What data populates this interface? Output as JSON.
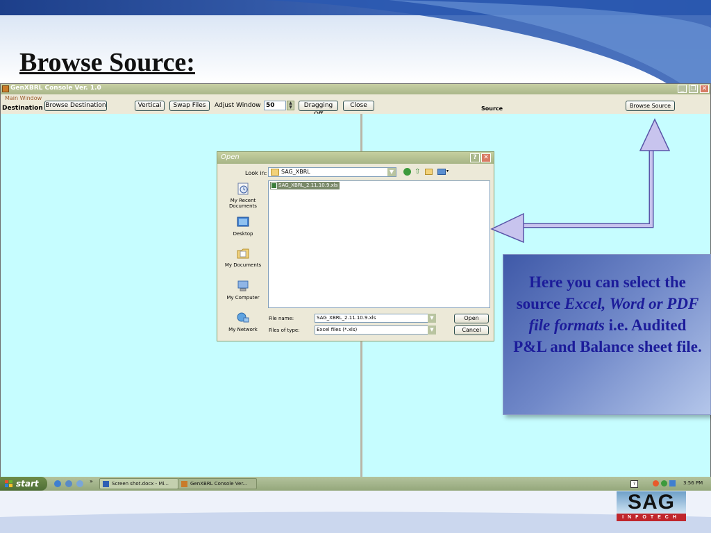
{
  "slide": {
    "title": "Browse Source:"
  },
  "app": {
    "window_title": "GenXBRL Console Ver. 1.0",
    "menu_item": "Main Window",
    "toolbar": {
      "destination_label": "Destination",
      "browse_destination": "Browse Destination",
      "vertical": "Vertical",
      "swap_files": "Swap Files",
      "adjust_window_label": "Adjust Window",
      "adjust_window_value": "50",
      "dragging": "Dragging Off",
      "close": "Close",
      "source_label": "Source",
      "browse_source": "Browse Source"
    }
  },
  "dialog": {
    "title": "Open",
    "look_in_label": "Look in:",
    "look_in_value": "SAG_XBRL",
    "places": [
      {
        "label": "My Recent Documents",
        "icon": "recent-documents-icon"
      },
      {
        "label": "Desktop",
        "icon": "desktop-icon"
      },
      {
        "label": "My Documents",
        "icon": "my-documents-icon"
      },
      {
        "label": "My Computer",
        "icon": "my-computer-icon"
      },
      {
        "label": "My Network",
        "icon": "my-network-icon"
      }
    ],
    "files": [
      "SAG_XBRL_2.11.10.9.xls"
    ],
    "file_name_label": "File name:",
    "file_name_value": "SAG_XBRL_2.11.10.9.xls",
    "file_type_label": "Files of type:",
    "file_type_value": "Excel files (*.xls)",
    "open_button": "Open",
    "cancel_button": "Cancel"
  },
  "callout": {
    "line1": "Here you can select the source ",
    "italic": "Excel, Word or PDF file formats",
    "line2": " i.e. Audited P&L and Balance sheet file."
  },
  "taskbar": {
    "start": "start",
    "tasks": [
      "Screen shot.docx - Mi...",
      "GenXBRL Console Ver..."
    ],
    "clock": "3:56 PM"
  },
  "logo": {
    "name": "SAG",
    "subtitle": "INFOTECH"
  },
  "colors": {
    "pane_bg": "#c6fdff",
    "callout_text": "#1c1c9a",
    "arrow_fill": "#c8c4ee",
    "arrow_stroke": "#5a55a8"
  }
}
